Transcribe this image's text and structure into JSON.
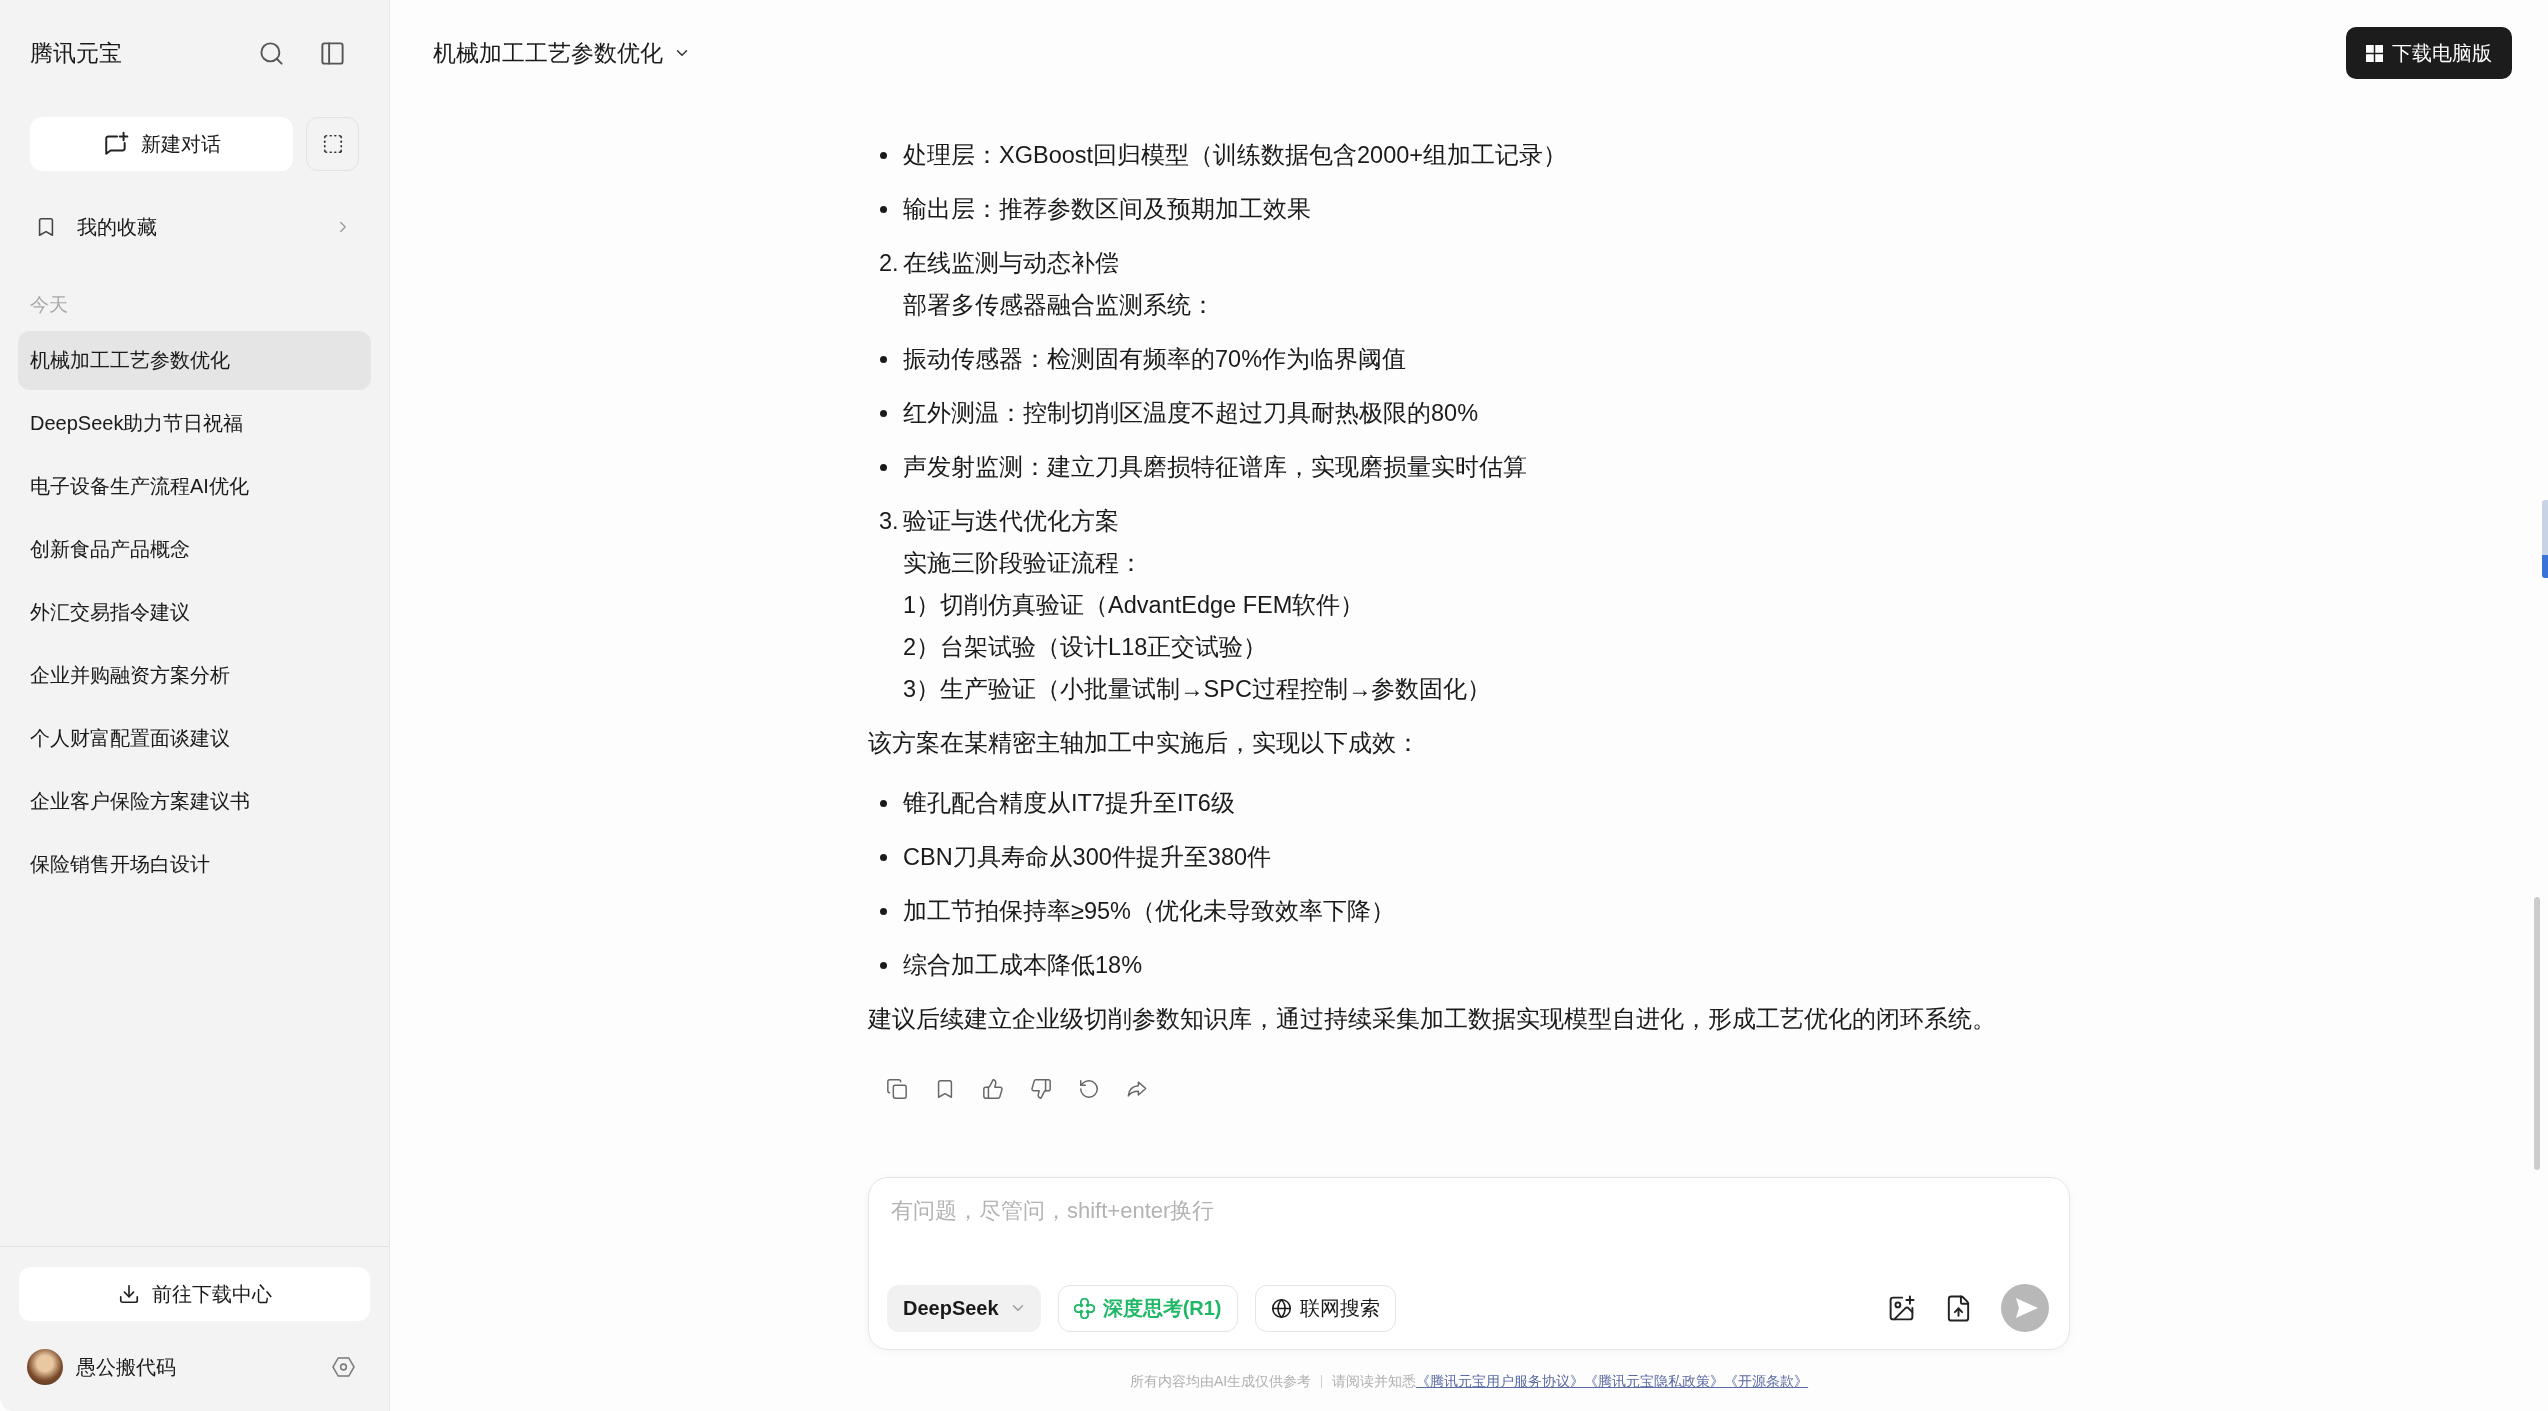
{
  "sidebar": {
    "title": "腾讯元宝",
    "new_chat": "新建对话",
    "favorites": "我的收藏",
    "section": "今天",
    "conversations": [
      {
        "title": "机械加工工艺参数优化",
        "selected": true
      },
      {
        "title": "DeepSeek助力节日祝福",
        "selected": false
      },
      {
        "title": "电子设备生产流程AI优化",
        "selected": false
      },
      {
        "title": "创新食品产品概念",
        "selected": false
      },
      {
        "title": "外汇交易指令建议",
        "selected": false
      },
      {
        "title": "企业并购融资方案分析",
        "selected": false
      },
      {
        "title": "个人财富配置面谈建议",
        "selected": false
      },
      {
        "title": "企业客户保险方案建议书",
        "selected": false
      },
      {
        "title": "保险销售开场白设计",
        "selected": false
      }
    ],
    "download_center": "前往下载中心",
    "user": {
      "name": "愚公搬代码"
    }
  },
  "header": {
    "title": "机械加工工艺参数优化",
    "download_button": "下载电脑版"
  },
  "message": {
    "blocks": [
      {
        "kind": "bullet",
        "text": "处理层：XGBoost回归模型（训练数据包含2000+组加工记录）"
      },
      {
        "kind": "bullet",
        "text": "输出层：推荐参数区间及预期加工效果"
      },
      {
        "kind": "numbered",
        "number": "2.",
        "title": "在线监测与动态补偿",
        "lines": [
          "部署多传感器融合监测系统："
        ]
      },
      {
        "kind": "bullet",
        "text": "振动传感器：检测固有频率的70%作为临界阈值"
      },
      {
        "kind": "bullet",
        "text": "红外测温：控制切削区温度不超过刀具耐热极限的80%"
      },
      {
        "kind": "bullet",
        "text": "声发射监测：建立刀具磨损特征谱库，实现磨损量实时估算"
      },
      {
        "kind": "numbered",
        "number": "3.",
        "title": "验证与迭代优化方案",
        "lines": [
          "实施三阶段验证流程：",
          "1）切削仿真验证（AdvantEdge FEM软件）",
          "2）台架试验（设计L18正交试验）",
          "3）生产验证（小批量试制→SPC过程控制→参数固化）"
        ]
      },
      {
        "kind": "paragraph",
        "text": "该方案在某精密主轴加工中实施后，实现以下成效："
      },
      {
        "kind": "bullet",
        "text": "锥孔配合精度从IT7提升至IT6级"
      },
      {
        "kind": "bullet",
        "text": "CBN刀具寿命从300件提升至380件"
      },
      {
        "kind": "bullet",
        "text": "加工节拍保持率≥95%（优化未导致效率下降）"
      },
      {
        "kind": "bullet",
        "text": "综合加工成本降低18%"
      },
      {
        "kind": "paragraph",
        "text": "建议后续建立企业级切削参数知识库，通过持续采集加工数据实现模型自进化，形成工艺优化的闭环系统。"
      }
    ]
  },
  "composer": {
    "placeholder": "有问题，尽管问，shift+enter换行",
    "model": "DeepSeek",
    "toggles": [
      {
        "kind": "think",
        "label": "深度思考(R1)",
        "on": true
      },
      {
        "kind": "web",
        "label": "联网搜索",
        "on": false
      }
    ]
  },
  "footer": {
    "notice": "所有内容均由AI生成仅供参考",
    "prompt": "请阅读并知悉",
    "links": [
      "《腾讯元宝用户服务协议》",
      "《腾讯元宝隐私政策》",
      "《开源条款》"
    ]
  }
}
